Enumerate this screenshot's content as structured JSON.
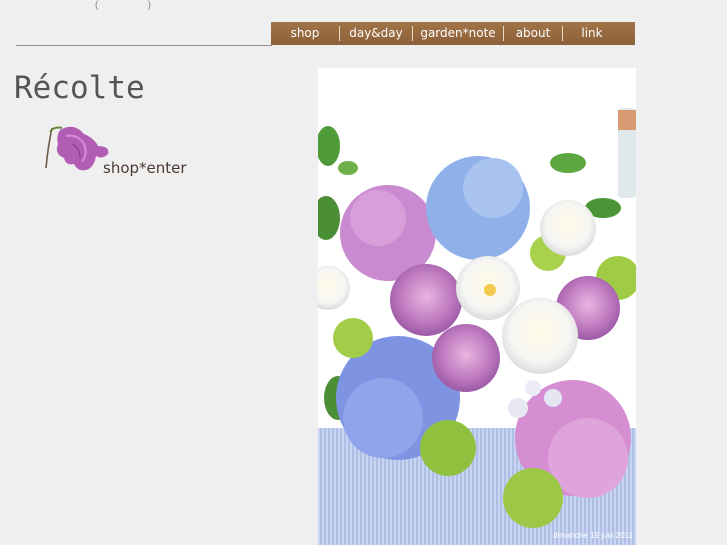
{
  "top_note": {
    "open": "(",
    "close": ")"
  },
  "nav": {
    "items": [
      {
        "label": "shop"
      },
      {
        "label": "day&day"
      },
      {
        "label": "garden*note"
      },
      {
        "label": "about"
      },
      {
        "label": "link"
      }
    ]
  },
  "site": {
    "title": "Récolte"
  },
  "enter": {
    "label": "shop*enter",
    "icon": "bellflower-icon"
  },
  "photo": {
    "caption": "dimanche 19 juin 2011",
    "description_icon": "flower-bouquet-image"
  },
  "colors": {
    "nav_bg": "#986a40",
    "page_bg": "#efefef",
    "title": "#555555"
  }
}
